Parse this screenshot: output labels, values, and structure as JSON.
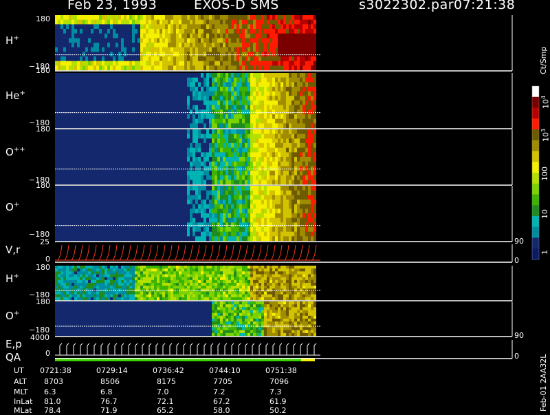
{
  "header": {
    "date": "Feb 23, 1993",
    "instrument": "EXOS-D SMS",
    "file": "s3022302.par",
    "time": "07:21:38"
  },
  "colorbar": {
    "unit": "Ct/Smp",
    "ticks": [
      "10",
      "10",
      "100",
      "10",
      "1"
    ],
    "powers": [
      "4",
      "3",
      "",
      "",
      ""
    ],
    "colors": [
      "#ffffff",
      "#7a0000",
      "#b80000",
      "#ff1a00",
      "#6e5a00",
      "#a08c00",
      "#d4c400",
      "#f4f000",
      "#b4e000",
      "#7ad200",
      "#3cb400",
      "#1e8c1e",
      "#00b4b4",
      "#008ca0",
      "#14286e",
      "#0a1a64"
    ]
  },
  "panels": [
    {
      "label": "H",
      "charge": "+",
      "top": "180",
      "bottom": "−180"
    },
    {
      "label": "He",
      "charge": "+",
      "top": "",
      "bottom": "−180"
    },
    {
      "label": "O",
      "charge": "++",
      "top": "180",
      "bottom": "−180"
    },
    {
      "label": "O",
      "charge": "+",
      "top": "180",
      "bottom": "−180"
    },
    {
      "label": "V",
      "charge": "",
      "suffix": ",r",
      "top": "25",
      "bottom": "0",
      "right_top": "90",
      "right_bottom": "0"
    },
    {
      "label": "H",
      "charge": "+",
      "top": "180",
      "bottom": "−180"
    },
    {
      "label": "O",
      "charge": "+",
      "top": "180",
      "bottom": "−180",
      "right_top": "90"
    },
    {
      "label": "E,p",
      "charge": "",
      "top": "4000",
      "bottom": "0",
      "right_top": "",
      "right_bottom": "0"
    }
  ],
  "extra_labels": {
    "qa": "QA",
    "top_180_he": "180"
  },
  "footer": {
    "rows": [
      {
        "label": "UT",
        "values": [
          "0721:38",
          "0729:14",
          "0736:42",
          "0744:10",
          "0751:38"
        ]
      },
      {
        "label": "ALT",
        "values": [
          "8703",
          "8506",
          "8175",
          "7705",
          "7096"
        ]
      },
      {
        "label": "MLT",
        "values": [
          "6.3",
          "6.8",
          "7.0",
          "7.2",
          "7.3"
        ]
      },
      {
        "label": "InLat",
        "values": [
          "81.0",
          "76.7",
          "72.1",
          "67.2",
          "61.9"
        ]
      },
      {
        "label": "MLat",
        "values": [
          "78.4",
          "71.9",
          "65.2",
          "58.0",
          "50.2"
        ]
      }
    ]
  },
  "side_note": "Feb-01 2AA32L",
  "chart_data": {
    "type": "heatmap",
    "x": [
      "0721:38",
      "0729:14",
      "0736:42",
      "0744:10",
      "0751:38"
    ],
    "series": [
      {
        "name": "H+",
        "ylim": [
          -180,
          180
        ]
      },
      {
        "name": "He+",
        "ylim": [
          -180,
          180
        ]
      },
      {
        "name": "O++",
        "ylim": [
          -180,
          180
        ]
      },
      {
        "name": "O+",
        "ylim": [
          -180,
          180
        ]
      },
      {
        "name": "V,r",
        "ylim": [
          0,
          25
        ]
      },
      {
        "name": "H+",
        "ylim": [
          -180,
          180
        ]
      },
      {
        "name": "O+",
        "ylim": [
          -180,
          180
        ]
      },
      {
        "name": "E,p",
        "ylim": [
          0,
          4000
        ]
      }
    ],
    "color_scale": [
      "1",
      "10",
      "100",
      "10^3",
      "10^4"
    ]
  }
}
